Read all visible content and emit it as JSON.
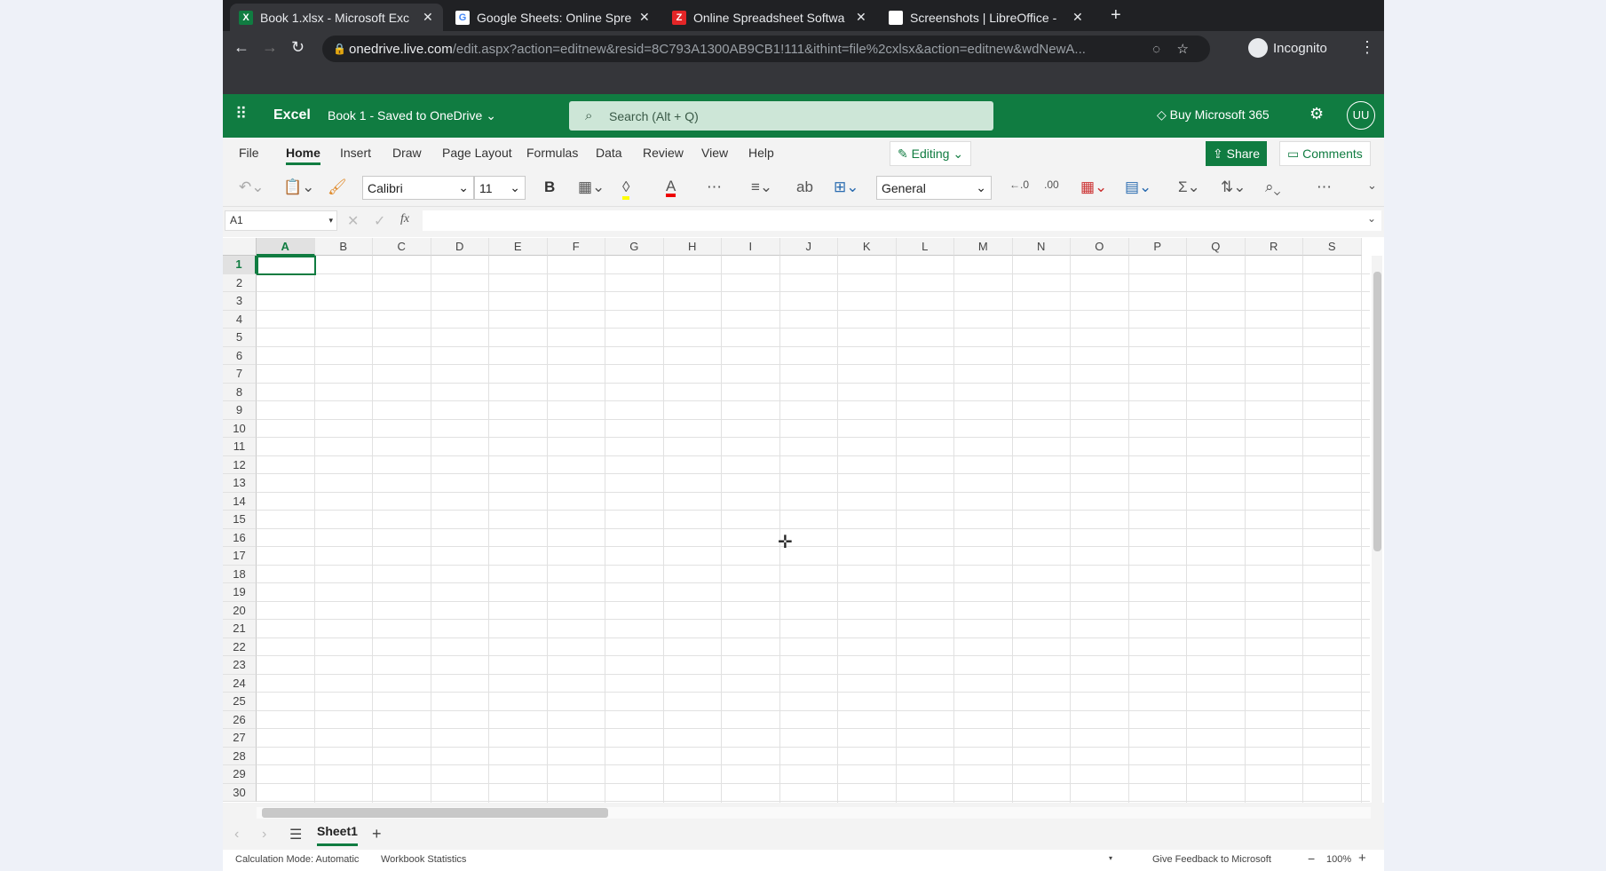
{
  "browser": {
    "tabs": [
      {
        "title": "Book 1.xlsx - Microsoft Exc",
        "icon": "excel-icon",
        "color": "#107c41",
        "glyph": "X",
        "active": true
      },
      {
        "title": "Google Sheets: Online Spre",
        "icon": "google-icon",
        "color": "#ffffff",
        "glyph": "G",
        "active": false
      },
      {
        "title": "Online Spreadsheet Softwa",
        "icon": "zoho-icon",
        "color": "#e42527",
        "glyph": "Z",
        "active": false
      },
      {
        "title": "Screenshots | LibreOffice -",
        "icon": "document-icon",
        "color": "#ffffff",
        "glyph": "",
        "active": false
      }
    ],
    "url_domain": "onedrive.live.com",
    "url_path": "/edit.aspx?action=editnew&resid=8C793A1300AB9CB1!111&ithint=file%2cxlsx&action=editnew&wdNewA...",
    "incognito": "Incognito"
  },
  "app": {
    "name": "Excel",
    "doc_title": "Book 1  -  Saved to OneDrive",
    "search_placeholder": "Search (Alt + Q)",
    "buy": "Buy Microsoft 365",
    "avatar": "UU"
  },
  "ribbon": {
    "tabs": [
      "File",
      "Home",
      "Insert",
      "Draw",
      "Page Layout",
      "Formulas",
      "Data",
      "Review",
      "View",
      "Help"
    ],
    "active": "Home",
    "editing": "Editing",
    "share": "Share",
    "comments": "Comments",
    "font": "Calibri",
    "size": "11",
    "bold": "B",
    "number_format": "General"
  },
  "formula": {
    "name_box": "A1",
    "fx": "fx",
    "value": ""
  },
  "grid": {
    "columns": [
      "A",
      "B",
      "C",
      "D",
      "E",
      "F",
      "G",
      "H",
      "I",
      "J",
      "K",
      "L",
      "M",
      "N",
      "O",
      "P",
      "Q",
      "R",
      "S"
    ],
    "row_count": 30,
    "selected": "A1"
  },
  "sheets": {
    "tabs": [
      "Sheet1"
    ],
    "active": "Sheet1"
  },
  "status": {
    "calc_mode": "Calculation Mode: Automatic",
    "stats": "Workbook Statistics",
    "feedback": "Give Feedback to Microsoft",
    "zoom": "100%"
  },
  "colors": {
    "accent": "#107c41"
  }
}
